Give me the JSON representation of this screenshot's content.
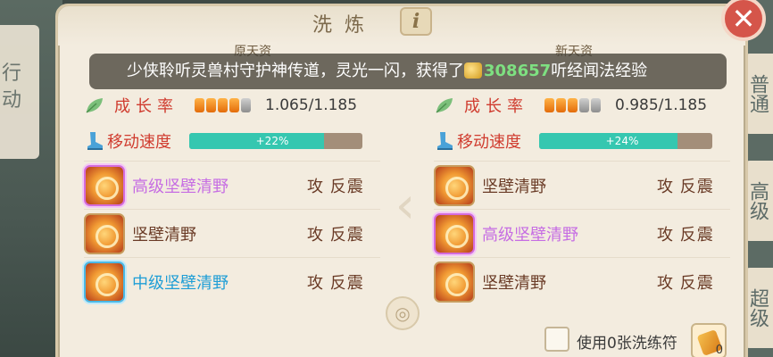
{
  "window": {
    "title": "洗炼",
    "info_icon": "i",
    "close_icon": "✕"
  },
  "toast": {
    "prefix": "少侠聆听灵兽村守护神传道，灵光一闪，获得了",
    "amount": "308657",
    "suffix": "听经闻法经验"
  },
  "headers": {
    "left": "原天资",
    "right": "新天资"
  },
  "left": {
    "growth": {
      "label": "成长率",
      "value": "1.065/1.185",
      "pips_on": 4,
      "pips_total": 5
    },
    "speed": {
      "label": "移动速度",
      "percent_text": "+22%",
      "fill_percent": 22
    },
    "skills": [
      {
        "name": "高级坚壁清野",
        "type": "攻 反震",
        "tier": "purple"
      },
      {
        "name": "坚壁清野",
        "type": "攻 反震",
        "tier": "normal"
      },
      {
        "name": "中级坚壁清野",
        "type": "攻 反震",
        "tier": "blue"
      }
    ]
  },
  "right": {
    "growth": {
      "label": "成长率",
      "value": "0.985/1.185",
      "pips_on": 3,
      "pips_total": 5
    },
    "speed": {
      "label": "移动速度",
      "percent_text": "+24%",
      "fill_percent": 24
    },
    "skills": [
      {
        "name": "坚壁清野",
        "type": "攻 反震",
        "tier": "normal"
      },
      {
        "name": "高级坚壁清野",
        "type": "攻 反震",
        "tier": "purple"
      },
      {
        "name": "坚壁清野",
        "type": "攻 反震",
        "tier": "normal"
      }
    ]
  },
  "footer": {
    "use_text": "使用0张洗练符",
    "item_count": "0"
  },
  "side_tabs": {
    "tab1": "普通",
    "tab2": "高级",
    "tab3": "超级"
  },
  "background": {
    "left_text": "行动"
  },
  "colors": {
    "accent_red": "#d03c2f",
    "teal_bar": "#35c7b0",
    "toast_highlight": "#7ee081",
    "purple_skill": "#c66de3",
    "blue_skill": "#1f9ed6"
  }
}
